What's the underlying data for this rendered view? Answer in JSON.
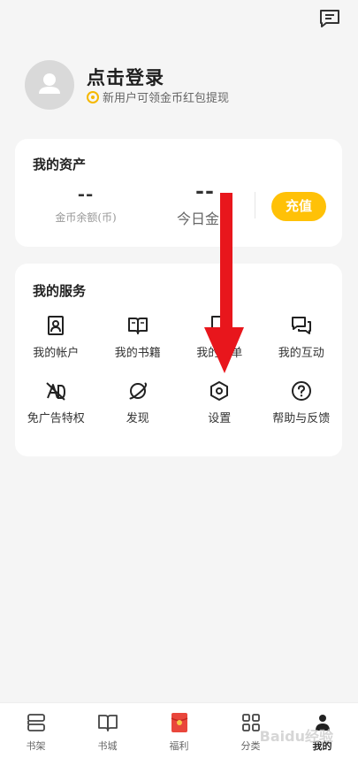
{
  "header": {
    "message_icon": "message-square-icon"
  },
  "profile": {
    "login_title": "点击登录",
    "login_subtitle": "新用户可领金币红包提现",
    "avatar_icon": "user-icon",
    "coin_icon": "coin-icon"
  },
  "assets": {
    "title": "我的资产",
    "coin_balance_value": "--",
    "coin_balance_label": "金币余额(币)",
    "today_coins_value": "--",
    "today_coins_label": "今日金币",
    "recharge_label": "充值",
    "accent_color": "#ffc107"
  },
  "services": {
    "title": "我的服务",
    "items": [
      {
        "label": "我的帐户",
        "icon": "account-portrait-icon"
      },
      {
        "label": "我的书籍",
        "icon": "open-book-icon"
      },
      {
        "label": "我的书单",
        "icon": "book-list-icon"
      },
      {
        "label": "我的互动",
        "icon": "chat-bubbles-icon"
      },
      {
        "label": "免广告特权",
        "icon": "no-ads-icon"
      },
      {
        "label": "发现",
        "icon": "planet-icon"
      },
      {
        "label": "设置",
        "icon": "settings-hexagon-icon"
      },
      {
        "label": "帮助与反馈",
        "icon": "help-circle-icon"
      }
    ]
  },
  "annotation": {
    "arrow_color": "#e8161c"
  },
  "tab_bar": {
    "tabs": [
      {
        "label": "书架",
        "icon": "bookshelf-icon"
      },
      {
        "label": "书城",
        "icon": "book-store-icon"
      },
      {
        "label": "福利",
        "icon": "red-envelope-icon"
      },
      {
        "label": "分类",
        "icon": "category-grid-icon"
      },
      {
        "label": "我的",
        "icon": "profile-icon",
        "active": true
      }
    ],
    "watermark": "Baidu经验"
  }
}
